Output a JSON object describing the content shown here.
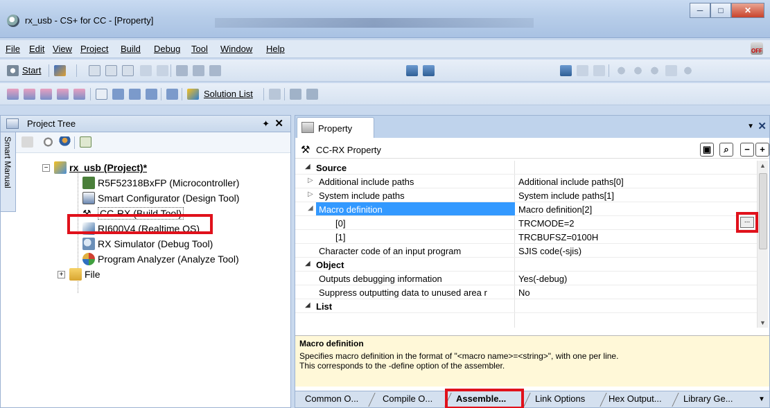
{
  "window": {
    "title": "rx_usb - CS+ for CC - [Property]",
    "min_glyph": "─",
    "max_glyph": "□",
    "close_glyph": "✕"
  },
  "menu": [
    "File",
    "Edit",
    "View",
    "Project",
    "Build",
    "Debug",
    "Tool",
    "Window",
    "Help"
  ],
  "toolbar": {
    "start_label": "Start",
    "solution_list_label": "Solution List"
  },
  "project_tree": {
    "header": "Project Tree",
    "pin_glyph": "✦",
    "close_glyph": "✕",
    "side_tab": "Smart Manual",
    "items": [
      {
        "label": "rx_usb (Project)*",
        "icon": "project-icon",
        "color": "#d9a020"
      },
      {
        "label": "R5F52318BxFP (Microcontroller)",
        "icon": "chip-icon",
        "color": "#4a7f3a"
      },
      {
        "label": "Smart Configurator (Design Tool)",
        "icon": "configurator-icon",
        "color": "#6a86b0"
      },
      {
        "label": "CC-RX (Build Tool)",
        "icon": "hammer-icon",
        "color": "#555555"
      },
      {
        "label": "RI600V4 (Realtime OS)",
        "icon": "os-icon",
        "color": "#3a6ea5"
      },
      {
        "label": "RX Simulator (Debug Tool)",
        "icon": "simulator-icon",
        "color": "#6b8fb8"
      },
      {
        "label": "Program Analyzer (Analyze Tool)",
        "icon": "analyzer-icon",
        "color": "#c08030"
      },
      {
        "label": "File",
        "icon": "folder-icon",
        "color": "#e0b84a"
      }
    ]
  },
  "property": {
    "tab_label": "Property",
    "title": "CC-RX Property",
    "rows": [
      {
        "type": "category",
        "key": "Source",
        "value": ""
      },
      {
        "type": "item",
        "key": "Additional include paths",
        "value": "Additional include paths[0]",
        "arrow": "▷"
      },
      {
        "type": "item",
        "key": "System include paths",
        "value": "System include paths[1]",
        "arrow": "▷"
      },
      {
        "type": "selected",
        "key": "Macro definition",
        "value": "Macro definition[2]",
        "arrow": "◢"
      },
      {
        "type": "sub",
        "key": "[0]",
        "value": "TRCMODE=2"
      },
      {
        "type": "sub",
        "key": "[1]",
        "value": "TRCBUFSZ=0100H"
      },
      {
        "type": "item",
        "key": "Character code of an input program",
        "value": "SJIS code(-sjis)"
      },
      {
        "type": "category",
        "key": "Object",
        "value": ""
      },
      {
        "type": "item",
        "key": "Outputs debugging information",
        "value": "Yes(-debug)"
      },
      {
        "type": "item",
        "key": "Suppress outputting data to unused area r",
        "value": "No"
      },
      {
        "type": "category",
        "key": "List",
        "value": ""
      }
    ],
    "ellipsis": "...",
    "description_title": "Macro definition",
    "description_lines": [
      "Specifies macro definition in the format of \"<macro name>=<string>\", with one per line.",
      "This corresponds to the -define option of the assembler."
    ],
    "bottom_tabs": [
      "Common O...",
      "Compile O...",
      "Assemble...",
      "Link Options",
      "Hex Output...",
      "Library Ge..."
    ]
  },
  "colors": {
    "highlight_red": "#e0111b",
    "selection_blue": "#3399ff",
    "desc_bg": "#fff8d8"
  }
}
